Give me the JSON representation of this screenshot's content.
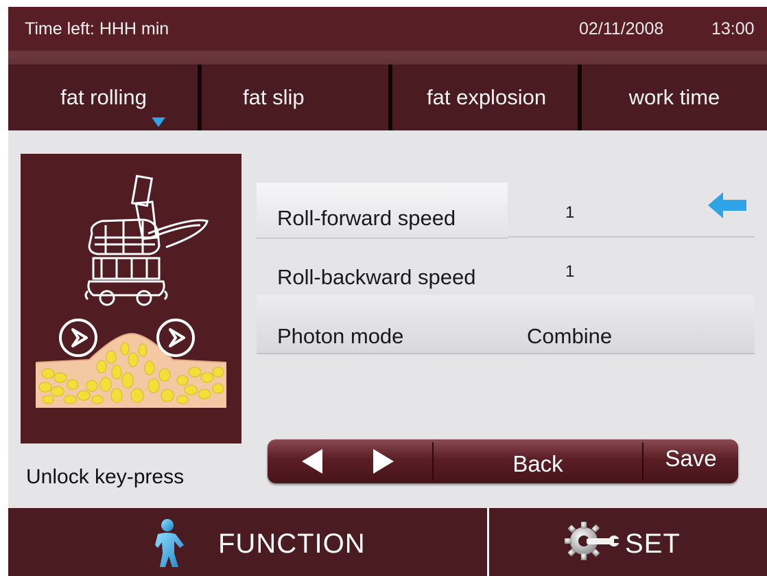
{
  "status_bar": {
    "time_left": "Time left:  HHH min",
    "date": "02/11/2008",
    "time": "13:00"
  },
  "tabs": [
    {
      "label": "fat rolling",
      "active": true
    },
    {
      "label": "fat slip",
      "active": false
    },
    {
      "label": "fat explosion",
      "active": false
    },
    {
      "label": "work time",
      "active": false
    }
  ],
  "settings": [
    {
      "label": "Roll-forward speed",
      "value": "1",
      "selected": true
    },
    {
      "label": "Roll-backward speed",
      "value": "1",
      "selected": false
    },
    {
      "label": "Photon mode",
      "value": "Combine",
      "selected": false
    }
  ],
  "unlock_label": "Unlock key-press",
  "buttons": {
    "prev_icon": "triangle-left-icon",
    "next_icon": "triangle-right-icon",
    "back": "Back",
    "save": "Save"
  },
  "bottom_nav": {
    "function": "FUNCTION",
    "set": "SET"
  },
  "colors": {
    "brand_maroon": "#4a1b20",
    "accent_blue": "#2ea3e6",
    "fat_yellow": "#f3de3a",
    "skin": "#f4c8a2"
  }
}
